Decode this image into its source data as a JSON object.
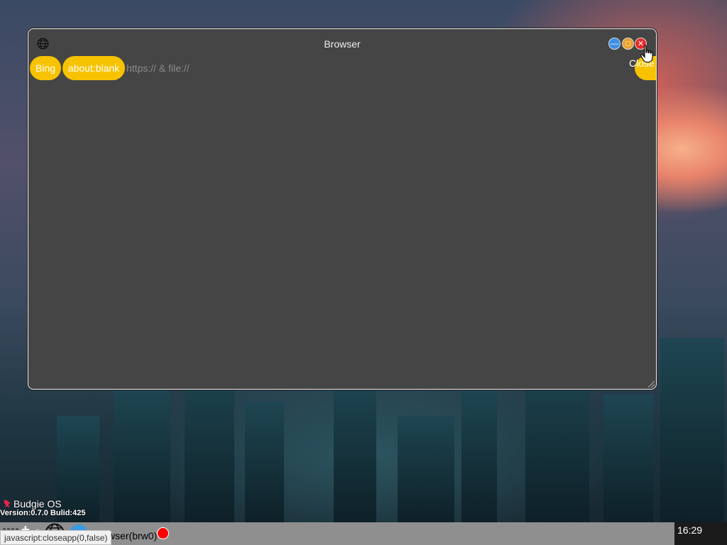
{
  "window": {
    "title": "Browser",
    "controls": {
      "minimize_glyph": "—",
      "maximize_glyph": "□",
      "close_glyph": "✕"
    },
    "nav": {
      "bookmark_bing": "Bing",
      "bookmark_blank": "about:blank",
      "url_placeholder": "https:// & file://",
      "url_value": "",
      "close_tooltip": "Close"
    }
  },
  "branding": {
    "os_name": "Budgie OS",
    "version_text": "Version:0.7.0  Bulid:425"
  },
  "taskbar": {
    "plus_label": "+",
    "minus_label": "-",
    "running_app_label": "wser(brw0)",
    "clock": "16:29"
  },
  "statusbar": {
    "link_text": "javascript:closeapp(0,false)"
  },
  "colors": {
    "pill_accent": "#f7c300",
    "window_bg": "#454545",
    "taskbar_bg": "#8f8f8f",
    "close_red": "#e52a2a",
    "minimize_blue": "#3d8ee6",
    "maximize_orange": "#e8a12e"
  },
  "icons": {
    "app_icon": "globe-icon",
    "cursor": "hand-pointer-icon",
    "os_logo": "budgie-bird-icon",
    "taskbar_launcher": "globe-icon",
    "taskbar_app": "blue-circle-icon",
    "recording_indicator": "red-dot-icon"
  }
}
